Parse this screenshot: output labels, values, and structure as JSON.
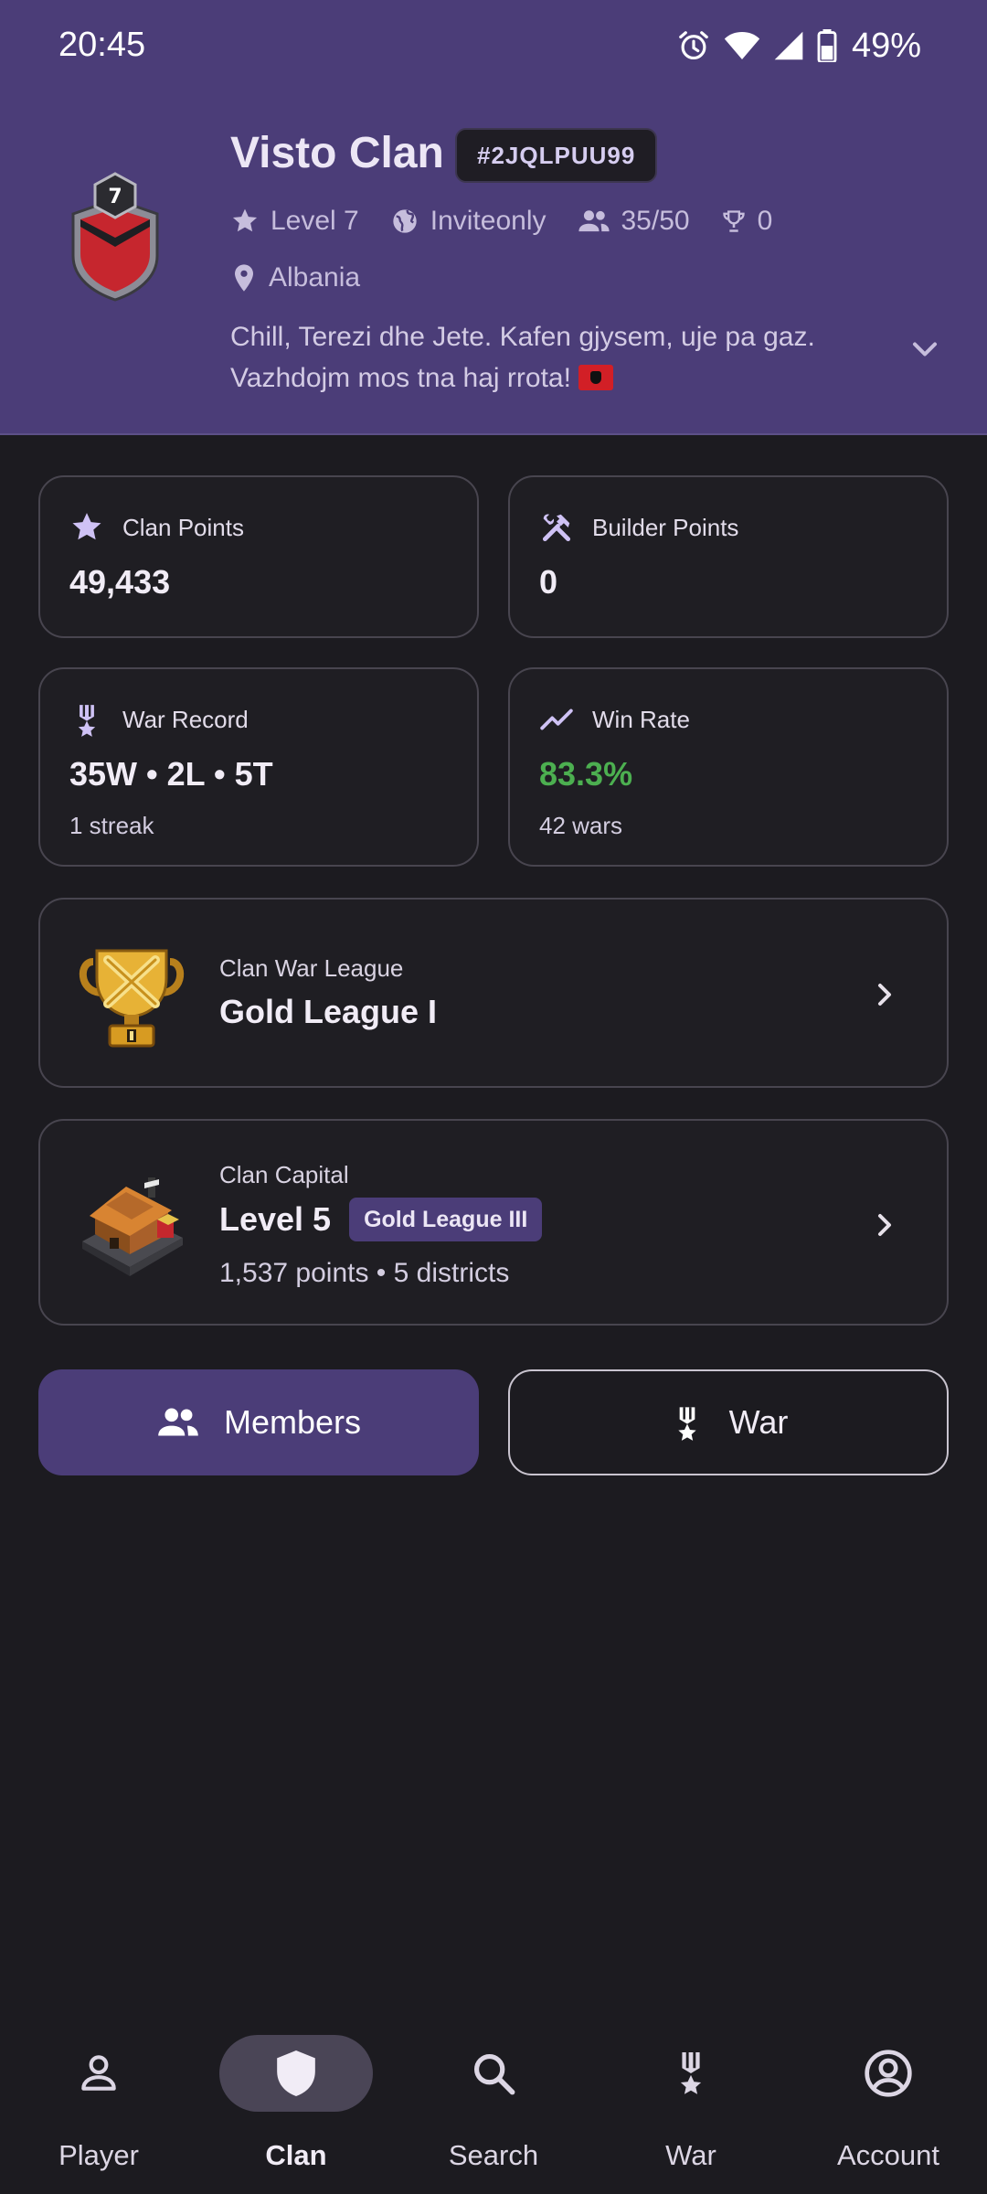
{
  "status_bar": {
    "time": "20:45",
    "battery": "49%"
  },
  "clan": {
    "name": "Visto Clan",
    "tag": "#2JQLPUU99",
    "badge_level": "7",
    "level": "Level 7",
    "type": "Inviteonly",
    "members": "35/50",
    "trophies": "0",
    "location": "Albania",
    "description": "Chill, Terezi dhe Jete. Kafen gjysem, uje pa gaz. Vazhdojm mos tna haj rrota!"
  },
  "stats": {
    "clan_points": {
      "label": "Clan Points",
      "value": "49,433"
    },
    "builder_points": {
      "label": "Builder Points",
      "value": "0"
    },
    "war_record": {
      "label": "War Record",
      "value": "35W • 2L • 5T",
      "sub": "1 streak"
    },
    "win_rate": {
      "label": "Win Rate",
      "value": "83.3%",
      "sub": "42 wars"
    }
  },
  "cwl": {
    "caption": "Clan War League",
    "title": "Gold League I"
  },
  "capital": {
    "caption": "Clan Capital",
    "title": "Level 5",
    "badge": "Gold League III",
    "sub": "1,537 points • 5 districts"
  },
  "actions": {
    "members": "Members",
    "war": "War"
  },
  "nav": {
    "player": "Player",
    "clan": "Clan",
    "search": "Search",
    "war": "War",
    "account": "Account"
  },
  "colors": {
    "header": "#4b3d78",
    "background": "#1c1b20",
    "accent_icon": "#cfc2f5",
    "win_rate": "#4caf50"
  }
}
